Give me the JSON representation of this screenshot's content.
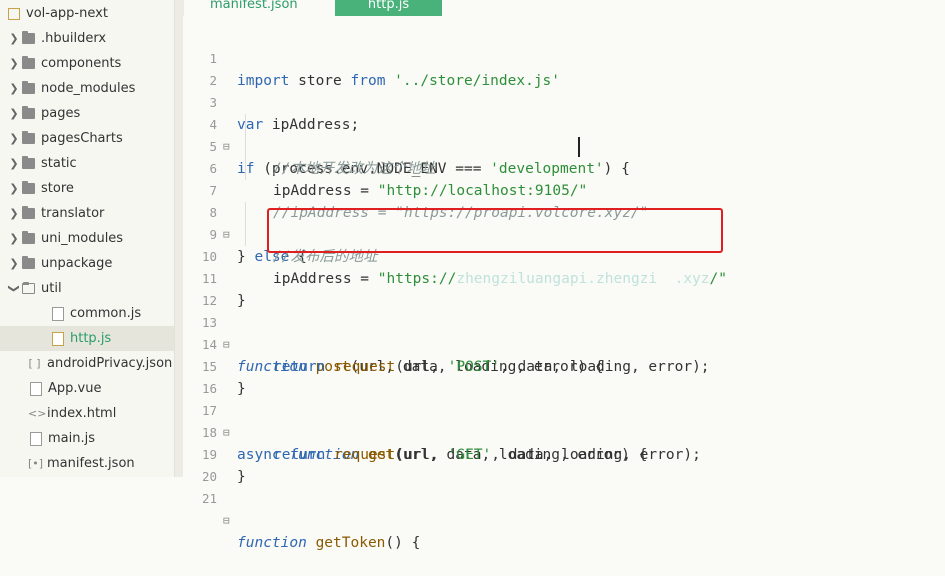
{
  "sidebar": {
    "project": "vol-app-next",
    "items": [
      {
        "label": ".hbuilderx"
      },
      {
        "label": "components"
      },
      {
        "label": "node_modules"
      },
      {
        "label": "pages"
      },
      {
        "label": "pagesCharts"
      },
      {
        "label": "static"
      },
      {
        "label": "store"
      },
      {
        "label": "translator"
      },
      {
        "label": "uni_modules"
      },
      {
        "label": "unpackage"
      },
      {
        "label": "util"
      },
      {
        "label": "common.js"
      },
      {
        "label": "http.js"
      },
      {
        "label": "androidPrivacy.json"
      },
      {
        "label": "App.vue"
      },
      {
        "label": "index.html"
      },
      {
        "label": "main.js"
      },
      {
        "label": "manifest.json"
      }
    ]
  },
  "tabs": [
    {
      "label": "manifest.json"
    },
    {
      "label": "http.js"
    }
  ],
  "editor": {
    "line_numbers": [
      "1",
      "2",
      "3",
      "4",
      "5",
      "6",
      "7",
      "8",
      "9",
      "10",
      "11",
      "12",
      "13",
      "14",
      "15",
      "16",
      "17",
      "18",
      "19",
      "20",
      "21"
    ],
    "l1": {
      "a": "import",
      "b": " store ",
      "c": "from",
      "d": " '../store/index.js'"
    },
    "l3": {
      "a": "var",
      "b": " ipAddress;"
    },
    "l4": {
      "a": "if",
      "b": " (process.env.NODE_ENV === ",
      "c": "'development'",
      "d": ") {"
    },
    "l5": "//本地开发改为这个地址",
    "l6": {
      "a": "ipAddress = ",
      "b": "\"http://localhost:9105/\""
    },
    "l7": "//ipAddress = \"https://proapi.volcore.xyz/\"",
    "l8": {
      "a": "} ",
      "b": "else",
      "c": " {"
    },
    "l9": "//发布后的地址",
    "l10": {
      "a": "ipAddress = ",
      "b": "\"https://",
      "c": "zhengziluangapi.zhengzi  .xyz",
      "d": "/\""
    },
    "l11": "}",
    "l13": {
      "a": "function",
      "b": " post",
      "c": "(url, data, loading, error) {"
    },
    "l14": {
      "a": "return",
      "b": " request",
      "c": "(url, ",
      "d": "'POST'",
      "e": ", data, loading, error);"
    },
    "l15": "}",
    "l17": {
      "a": "async",
      "b": " function",
      "c": " get",
      "d": "(url, data, loading, error) {"
    },
    "l18": {
      "a": "return",
      "b": " request",
      "c": "(url, ",
      "d": "'GET'",
      "e": ", data, loading, error);"
    },
    "l19": "}",
    "l21": {
      "a": "function",
      "b": " getToken",
      "c": "() {"
    }
  }
}
